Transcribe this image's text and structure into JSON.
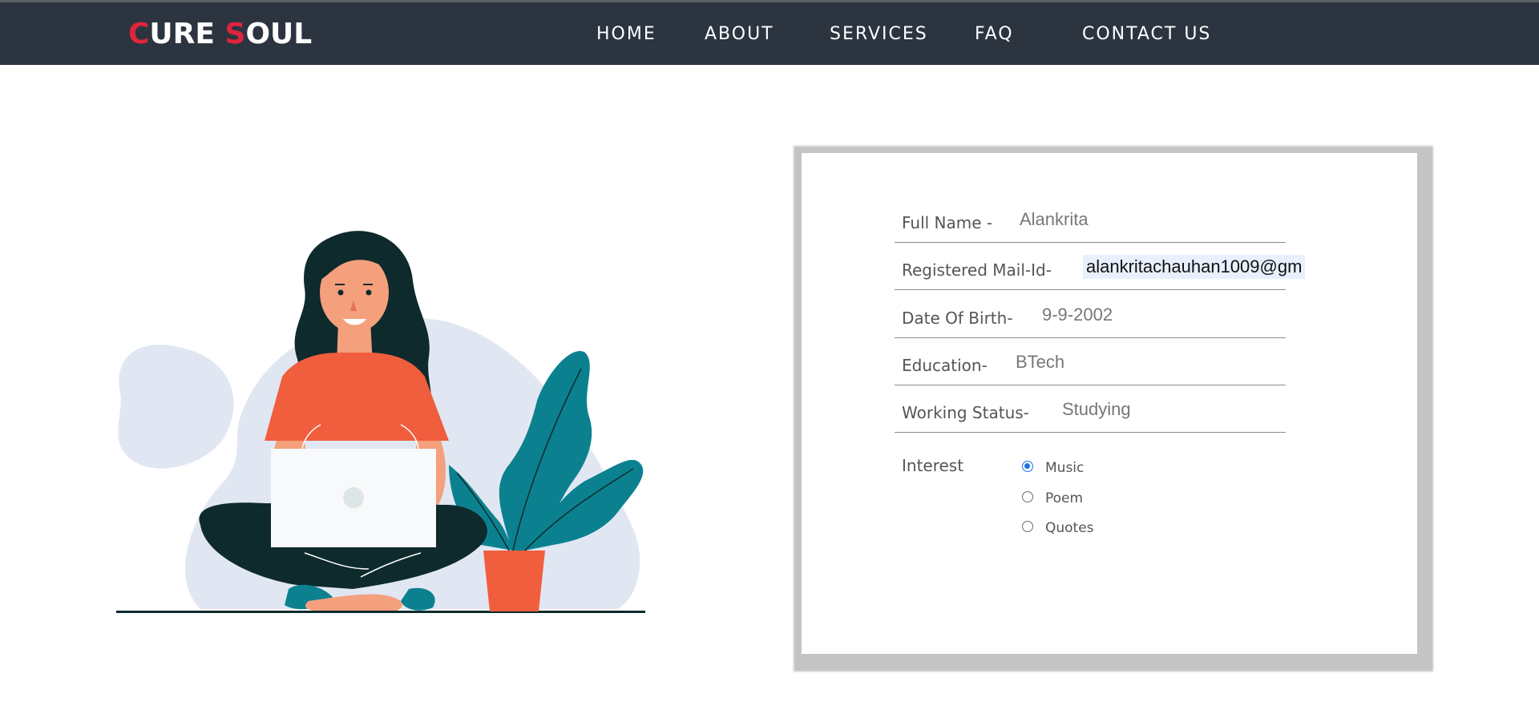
{
  "brand": {
    "c": "C",
    "ure": "URE ",
    "s": "S",
    "oul": "OUL"
  },
  "nav": [
    "HOME",
    "ABOUT",
    "SERVICES",
    "FAQ",
    "CONTACT US"
  ],
  "form": {
    "rows": [
      {
        "label": "Full Name -",
        "value": "Alankrita"
      },
      {
        "label": "Registered Mail-Id-",
        "value": "alankritachauhan1009@gm"
      },
      {
        "label": "Date Of Birth-",
        "value": "9-9-2002"
      },
      {
        "label": "Education-",
        "value": "BTech"
      },
      {
        "label": "Working Status-",
        "value": "Studying"
      }
    ],
    "interest_label": "Interest",
    "interest_options": [
      "Music",
      "Poem",
      "Quotes"
    ],
    "interest_selected": "Music"
  },
  "colors": {
    "navbar": "#2c3440",
    "brand_accent": "#e0243c",
    "radio_selected": "#1a73e8"
  }
}
